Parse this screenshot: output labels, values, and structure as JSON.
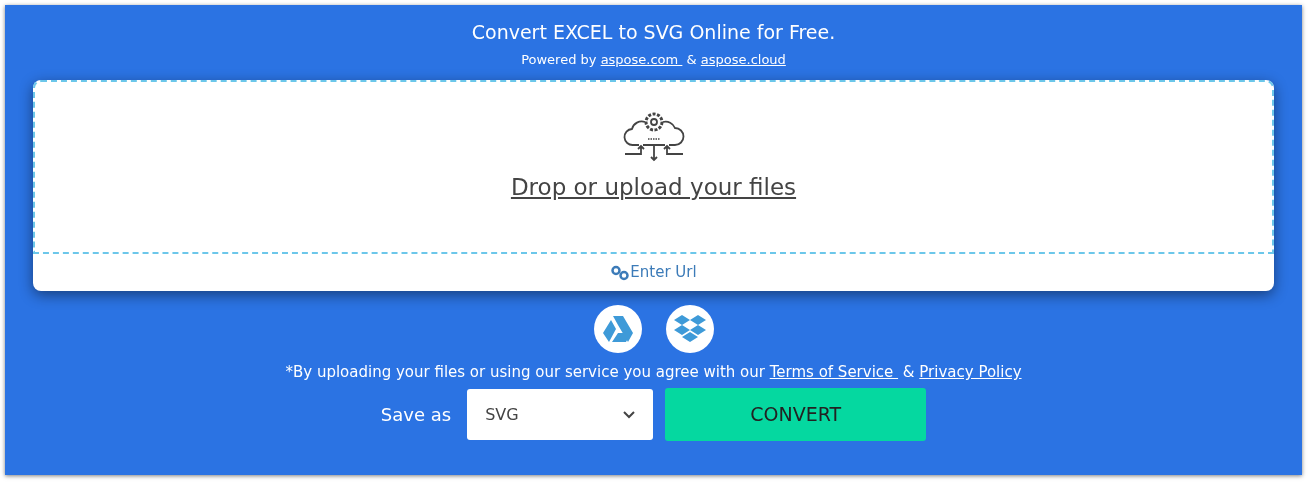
{
  "header": {
    "title": "Convert EXCEL to SVG Online for Free.",
    "powered_by": [
      {
        "kind": "text",
        "text": "Powered by "
      },
      {
        "kind": "link",
        "text": "aspose.com "
      },
      {
        "kind": "text",
        "text": " & "
      },
      {
        "kind": "link",
        "text": "aspose.cloud"
      }
    ]
  },
  "upload": {
    "drop_label": "Drop or upload your files",
    "url_label": "Enter Url"
  },
  "agreement": [
    {
      "kind": "text",
      "text": "*By uploading your files or using our service you agree with our "
    },
    {
      "kind": "link",
      "text": "Terms of Service "
    },
    {
      "kind": "text",
      "text": " & "
    },
    {
      "kind": "link",
      "text": "Privacy Policy"
    }
  ],
  "save_as": {
    "label": "Save as",
    "value": "SVG"
  },
  "convert_button": "CONVERT"
}
